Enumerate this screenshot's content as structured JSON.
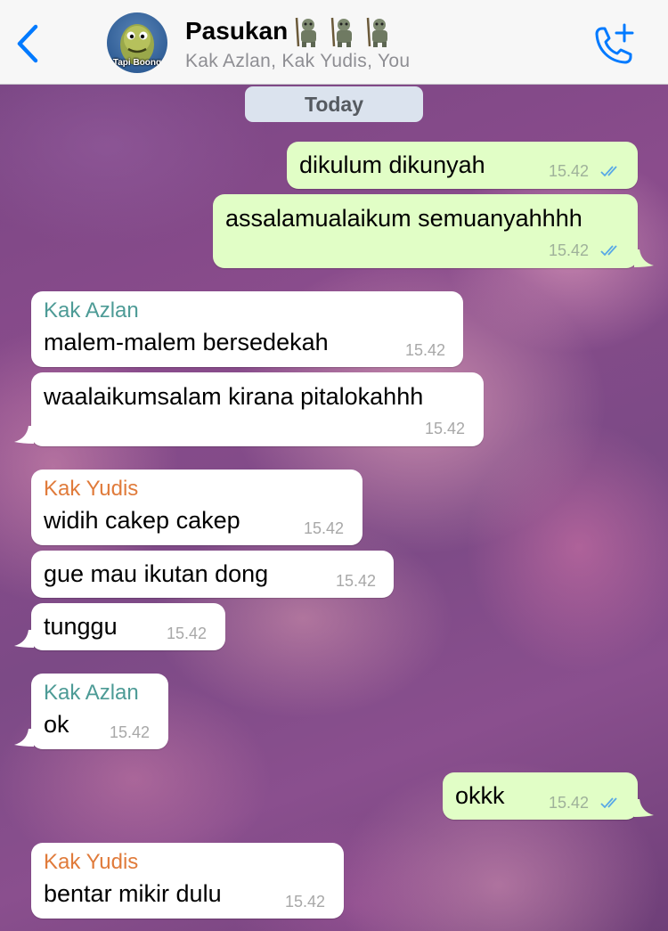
{
  "header": {
    "group_name": "Pasukan",
    "members": "Kak Azlan, Kak Yudis, You",
    "avatar_caption": "Tapi Boong"
  },
  "date_separator": "Today",
  "colors": {
    "accent": "#007aff",
    "outgoing_bubble": "#e1fec6",
    "incoming_bubble": "#ffffff",
    "sender_azlan": "#4d9b96",
    "sender_yudis": "#e07b3b",
    "read_ticks": "#58a8e6"
  },
  "messages": [
    {
      "direction": "out",
      "text": "dikulum dikunyah",
      "time": "15.42",
      "status": "read"
    },
    {
      "direction": "out",
      "text": "assalamualaikum semuanyahhhh",
      "time": "15.42",
      "status": "read"
    },
    {
      "direction": "in",
      "sender": "Kak Azlan",
      "text": "malem-malem bersedekah",
      "time": "15.42"
    },
    {
      "direction": "in",
      "text": "waalaikumsalam kirana pitalokahhh",
      "time": "15.42"
    },
    {
      "direction": "in",
      "sender": "Kak Yudis",
      "text": "widih cakep cakep",
      "time": "15.42"
    },
    {
      "direction": "in",
      "text": "gue mau ikutan dong",
      "time": "15.42"
    },
    {
      "direction": "in",
      "text": "tunggu",
      "time": "15.42"
    },
    {
      "direction": "in",
      "sender": "Kak Azlan",
      "text": "ok",
      "time": "15.42"
    },
    {
      "direction": "out",
      "text": "okkk",
      "time": "15.42",
      "status": "read"
    },
    {
      "direction": "in",
      "sender": "Kak Yudis",
      "text": "bentar mikir dulu",
      "time": "15.42"
    }
  ]
}
